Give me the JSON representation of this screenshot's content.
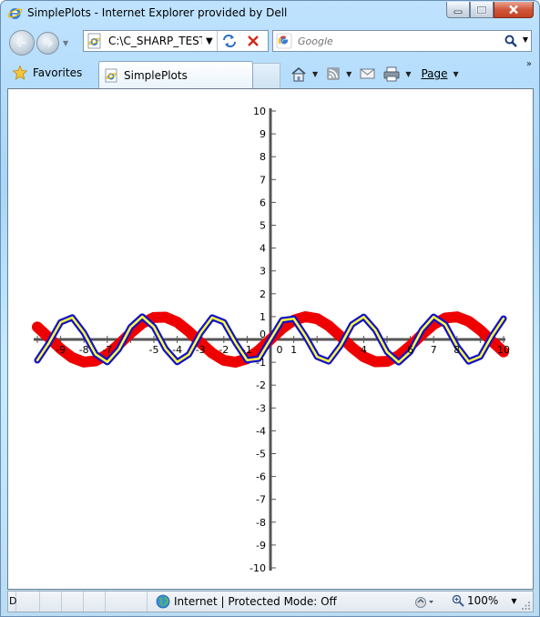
{
  "window": {
    "title": "SimplePlots - Internet Explorer provided by Dell"
  },
  "navbar": {
    "address": "C:\\C_SHARP_TESTS",
    "search_placeholder": "Google"
  },
  "commandbar": {
    "favorites_label": "Favorites",
    "tab_label": "SimplePlots",
    "page_menu_label": "Page"
  },
  "status": {
    "left_text": "D",
    "zone_text": "Internet | Protected Mode: Off",
    "zoom_text": "100%"
  },
  "chart_data": {
    "type": "line",
    "title": "",
    "xlabel": "",
    "ylabel": "",
    "xlim": [
      -10,
      10
    ],
    "ylim": [
      -10,
      10
    ],
    "grid": false,
    "x_ticks": [
      -10,
      -9,
      -8,
      -7,
      -6,
      -5,
      -4,
      -3,
      -2,
      -1,
      0,
      1,
      2,
      3,
      4,
      5,
      6,
      7,
      8,
      9,
      10
    ],
    "y_ticks": [
      -10,
      -9,
      -8,
      -7,
      -6,
      -5,
      -4,
      -3,
      -2,
      -1,
      0,
      1,
      2,
      3,
      4,
      5,
      6,
      7,
      8,
      9,
      10
    ],
    "x_tick_labels": [
      "-9",
      "-8",
      "-7",
      "-5",
      "-4",
      "-3",
      "-2",
      "-1",
      "0",
      "1",
      "4",
      "6",
      "7",
      "8",
      "10"
    ],
    "y_tick_labels": [
      "10",
      "9",
      "8",
      "7",
      "6",
      "5",
      "4",
      "3",
      "2",
      "1",
      "0",
      "-1",
      "-2",
      "-3",
      "-4",
      "-5",
      "-6",
      "-7",
      "-8",
      "-9",
      "-10"
    ],
    "series": [
      {
        "function": "sin(x)",
        "color": "#ee0000",
        "x": [
          -10,
          -9.5,
          -9,
          -8.5,
          -8,
          -7.5,
          -7,
          -6.5,
          -6,
          -5.5,
          -5,
          -4.5,
          -4,
          -3.5,
          -3,
          -2.5,
          -2,
          -1.5,
          -1,
          -0.5,
          0,
          0.5,
          1,
          1.5,
          2,
          2.5,
          3,
          3.5,
          4,
          4.5,
          5,
          5.5,
          6,
          6.5,
          7,
          7.5,
          8,
          8.5,
          9,
          9.5,
          10
        ],
        "y": [
          0.544,
          0.075,
          -0.412,
          -0.798,
          -0.989,
          -0.938,
          -0.657,
          -0.215,
          0.279,
          0.706,
          0.959,
          0.978,
          0.757,
          0.351,
          -0.141,
          -0.598,
          -0.909,
          -0.997,
          -0.841,
          -0.479,
          0,
          0.479,
          0.841,
          0.997,
          0.909,
          0.598,
          0.141,
          -0.351,
          -0.757,
          -0.978,
          -0.959,
          -0.706,
          -0.279,
          0.215,
          0.657,
          0.938,
          0.989,
          0.798,
          0.412,
          -0.075,
          -0.544
        ]
      },
      {
        "function": "sin(2x)",
        "color": "#1212c8",
        "inner_color": "#ffff44",
        "x": [
          -10,
          -9.5,
          -9,
          -8.5,
          -8,
          -7.5,
          -7,
          -6.5,
          -6,
          -5.5,
          -5,
          -4.5,
          -4,
          -3.5,
          -3,
          -2.5,
          -2,
          -1.5,
          -1,
          -0.5,
          0,
          0.5,
          1,
          1.5,
          2,
          2.5,
          3,
          3.5,
          4,
          4.5,
          5,
          5.5,
          6,
          6.5,
          7,
          7.5,
          8,
          8.5,
          9,
          9.5,
          10
        ],
        "y": [
          -0.913,
          -0.151,
          0.751,
          0.961,
          0.288,
          -0.65,
          -0.991,
          -0.42,
          0.537,
          1.0,
          0.544,
          -0.412,
          -0.989,
          -0.657,
          0.279,
          0.959,
          0.757,
          -0.141,
          -0.909,
          -0.841,
          0,
          0.841,
          0.909,
          0.141,
          -0.757,
          -0.959,
          -0.279,
          0.657,
          0.989,
          0.412,
          -0.544,
          -1.0,
          -0.537,
          0.42,
          0.991,
          0.65,
          -0.288,
          -0.961,
          -0.751,
          0.151,
          0.913
        ]
      }
    ]
  }
}
